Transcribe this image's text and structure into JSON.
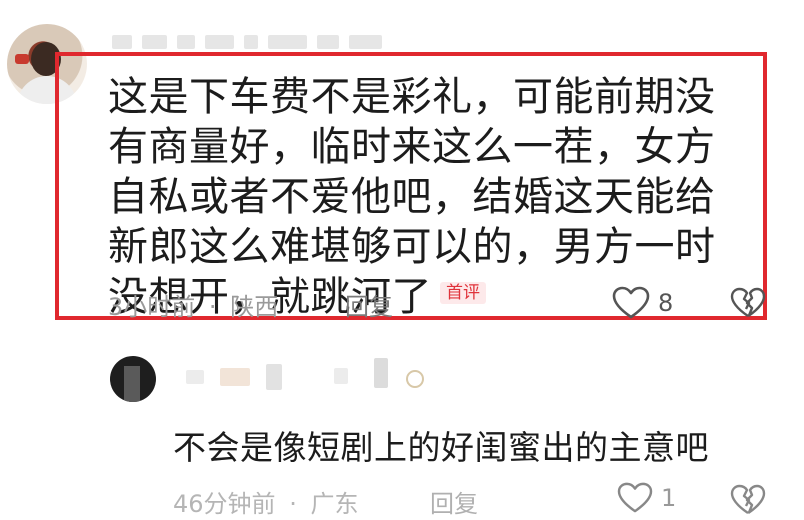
{
  "comment1": {
    "text": "这是下车费不是彩礼，可能前期没有商量好，临时来这么一茬，女方自私或者不爱他吧，结婚这天能给新郎这么难堪够可以的，男方一时没想开，就跳河了",
    "badge": "首评",
    "time": "3小时前",
    "separator": "·",
    "location": "陕西",
    "reply_label": "回复",
    "like_count": "8",
    "icons": {
      "like": "heart-icon",
      "dislike": "broken-heart-icon"
    }
  },
  "comment2": {
    "text": "不会是像短剧上的好闺蜜出的主意吧",
    "time": "46分钟前",
    "separator": "·",
    "location": "广东",
    "reply_label": "回复",
    "like_count": "1",
    "icons": {
      "like": "heart-icon",
      "dislike": "broken-heart-icon"
    }
  },
  "colors": {
    "highlight_border": "#e0282e",
    "badge": "#e0323a"
  }
}
